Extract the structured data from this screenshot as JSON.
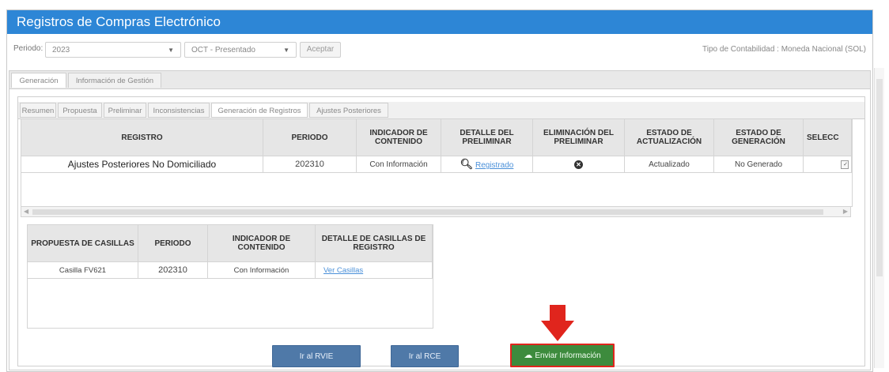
{
  "window": {
    "title": "Registros de Compras Electrónico"
  },
  "periodo": {
    "label": "Periodo:",
    "year": "2023",
    "month": "OCT - Presentado",
    "accept_label": "Aceptar",
    "tipo_contabilidad": "Tipo de Contabilidad : Moneda Nacional (SOL)"
  },
  "main_tabs": [
    {
      "label": "Generación",
      "active": true
    },
    {
      "label": "Información de Gestión",
      "active": false
    }
  ],
  "sub_tabs": [
    {
      "label": "Resumen"
    },
    {
      "label": "Propuesta"
    },
    {
      "label": "Preliminar"
    },
    {
      "label": "Inconsistencias"
    },
    {
      "label": "Generación de Registros",
      "active": true
    },
    {
      "label": "Ajustes Posteriores"
    }
  ],
  "registros_table": {
    "headers": [
      "REGISTRO",
      "PERIODO",
      "INDICADOR DE CONTENIDO",
      "DETALLE DEL PRELIMINAR",
      "ELIMINACIÓN DEL PRELIMINAR",
      "ESTADO DE ACTUALIZACIÓN",
      "ESTADO DE GENERACIÓN",
      "SELECC"
    ],
    "rows": [
      {
        "registro": "Ajustes Posteriores No Domiciliado",
        "periodo": "202310",
        "indicador": "Con Información",
        "detalle": "Registrado",
        "estado_actualizacion": "Actualizado",
        "estado_generacion": "No Generado"
      }
    ]
  },
  "casillas_table": {
    "headers": [
      "PROPUESTA DE CASILLAS",
      "PERIODO",
      "INDICADOR DE CONTENIDO",
      "DETALLE DE CASILLAS DE REGISTRO"
    ],
    "rows": [
      {
        "propuesta": "Casilla FV621",
        "periodo": "202310",
        "indicador": "Con Información",
        "detalle": "Ver Casillas"
      }
    ]
  },
  "buttons": {
    "rvie": "Ir al RVIE",
    "rce": "Ir al RCE",
    "enviar": "Enviar Información"
  },
  "colors": {
    "title_bar": "#2d86d6",
    "blue_button": "#4f79a8",
    "green_button": "#3d8b3d",
    "highlight": "#e0251d"
  }
}
